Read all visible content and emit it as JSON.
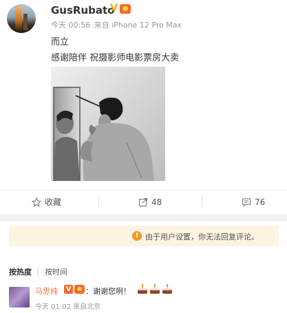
{
  "post": {
    "username": "GusRubato",
    "verified_mark": "V",
    "time": "今天 00:56",
    "source": "来自 iPhone 12 Pro Max",
    "text_line1": "而立",
    "text_line2": "感谢陪伴 祝摄影师电影票房大卖",
    "image": "black-and-white photo of shirtless man shaving in front of mirror"
  },
  "actions": {
    "favorite_label": "收藏",
    "repost_count": "48",
    "comment_count": "76"
  },
  "notice": {
    "icon": "!",
    "text": "由于用户设置，你无法回复评论。"
  },
  "sort": {
    "hot_label": "按热度",
    "time_label": "按时间"
  },
  "comments": [
    {
      "name": "马思纯",
      "badge": "V",
      "text": "：谢谢您咧！",
      "emoji": [
        "cake-emoji",
        "cake-emoji",
        "cake-emoji"
      ],
      "time": "今天 01:02 来自北京"
    }
  ],
  "colors": {
    "accent_orange": "#f7a600",
    "commenter_name": "#eb7350",
    "notice_bg": "#fdf3e3",
    "notice_icon": "#f59a23"
  }
}
